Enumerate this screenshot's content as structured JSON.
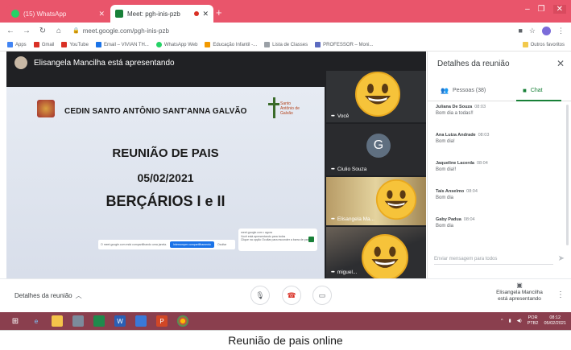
{
  "browser": {
    "tabs": [
      {
        "label": "(15) WhatsApp",
        "icon": "whatsapp-icon"
      },
      {
        "label": "Meet: pgh-inis-pzb",
        "icon": "meet-icon"
      }
    ],
    "url": "meet.google.com/pgh-inis-pzb",
    "bookmarks": [
      {
        "label": "Apps",
        "color": "#4285f4"
      },
      {
        "label": "Gmail",
        "color": "#d93025"
      },
      {
        "label": "YouTube",
        "color": "#d93025"
      },
      {
        "label": "Email – VIVIAN TH...",
        "color": "#1a73e8"
      },
      {
        "label": "WhatsApp Web",
        "color": "#25d366"
      },
      {
        "label": "Educação Infantil -...",
        "color": "#f29900"
      },
      {
        "label": "Lista de Classes",
        "color": "#9aa0a6"
      },
      {
        "label": "PROFESSOR – Moni...",
        "color": "#5c6bc0"
      }
    ],
    "other_bookmarks": "Outros favoritos"
  },
  "meet": {
    "presenter_banner": "Elisangela Mancilha está apresentando",
    "slide": {
      "school": "CEDIN SANTO ANTÔNIO SANT'ANNA GALVÃO",
      "logo_text": "Santo Antônio de Galvão",
      "title": "REUNIÃO DE PAIS",
      "date": "05/02/2021",
      "group": "BERÇÁRIOS I e II"
    },
    "share_bar": {
      "text": "O meet.google.com está compartilhando uma janela.",
      "stop": "Interromper compartilhamento",
      "hide": "Ocultar"
    },
    "notification": {
      "line1": "meet.google.com • agora",
      "line2": "Você está apresentando para todos",
      "line3": "Clique na opção Ocultar para esconder a barra de partilha."
    },
    "tiles": [
      {
        "name": "Você"
      },
      {
        "name": "Ciulio Souza",
        "initial": "G"
      },
      {
        "name": "Elisangela Ma..."
      },
      {
        "name": "miguel..."
      }
    ]
  },
  "panel": {
    "title": "Detalhes da reunião",
    "tab_people": "Pessoas (38)",
    "tab_chat": "Chat",
    "messages": [
      {
        "author": "Juliana De Souza",
        "time": "08:03",
        "text": "Bom dia a todas!!"
      },
      {
        "author": "Ana Luiza Andrade",
        "time": "08:03",
        "text": "Bom dia!"
      },
      {
        "author": "Jaqueline Lacerda",
        "time": "08:04",
        "text": "Bom dia!!"
      },
      {
        "author": "Taís Anselmo",
        "time": "08:04",
        "text": "Bom dia"
      },
      {
        "author": "Gaby Padua",
        "time": "08:04",
        "text": "Bom dia"
      }
    ],
    "composer_placeholder": "Enviar mensagem para todos"
  },
  "controls": {
    "details": "Detalhes da reunião",
    "presenting_name": "Elisangela Mancilha",
    "presenting_status": "está apresentando"
  },
  "taskbar": {
    "lang": "POR",
    "layout": "PTB2",
    "time": "08:12",
    "date": "05/02/2021"
  },
  "caption": "Reunião de pais online"
}
